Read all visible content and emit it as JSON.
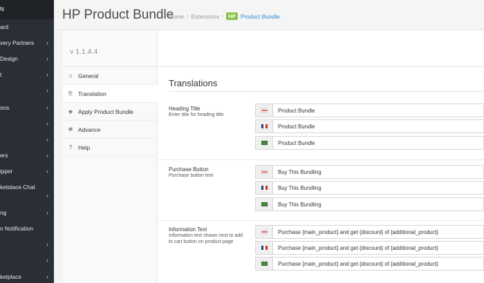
{
  "sidebar": {
    "header": "N",
    "items": [
      {
        "label": "ard",
        "chevron": false
      },
      {
        "label": "very Partners",
        "chevron": true
      },
      {
        "label": "Design",
        "chevron": true
      },
      {
        "label": "t",
        "chevron": true
      },
      {
        "label": "",
        "chevron": true
      },
      {
        "label": "ons",
        "chevron": true
      },
      {
        "label": "",
        "chevron": true
      },
      {
        "label": "",
        "chevron": true
      },
      {
        "label": "ers",
        "chevron": true
      },
      {
        "label": "ipper",
        "chevron": true
      },
      {
        "label": "ketplace Chat",
        "chevron": false
      },
      {
        "label": "",
        "chevron": true
      },
      {
        "label": "ng",
        "chevron": true
      },
      {
        "label": "n Notification",
        "chevron": false
      },
      {
        "label": "",
        "chevron": true
      },
      {
        "label": "",
        "chevron": true
      },
      {
        "label": "ketplace",
        "chevron": true
      }
    ]
  },
  "header": {
    "title": "HP Product Bundle",
    "breadcrumb": {
      "home": "Home",
      "extensions": "Extensions",
      "badge": "HP",
      "current": "Product Bundle"
    }
  },
  "version": "v 1.1.4.4",
  "tabs": [
    {
      "label": "General",
      "icon": "home-icon",
      "glyph": "⌂"
    },
    {
      "label": "Translation",
      "icon": "translation-icon",
      "glyph": "⎘"
    },
    {
      "label": "Apply Product Bundle",
      "icon": "cube-icon",
      "glyph": "◈"
    },
    {
      "label": "Advance",
      "icon": "cog-icon",
      "glyph": "✻"
    },
    {
      "label": "Help",
      "icon": "question-icon",
      "glyph": "?"
    }
  ],
  "active_tab": "Translation",
  "section_title": "Translations",
  "groups": [
    {
      "label": "Heading Title",
      "hint": "Enter title for heading title",
      "values": [
        "Product Bundle",
        "Product Bundle",
        "Product Bundle"
      ]
    },
    {
      "label": "Purchase Button",
      "hint": "Purchase button text",
      "values": [
        "Buy This Bundling",
        "Buy This Bundling",
        "Buy This Bundling"
      ]
    },
    {
      "label": "Information Text",
      "hint": "Information text shown next to add to cart button on product page",
      "values": [
        "Purchase {main_product} and get {discount} of {additional_product}",
        "Purchase {main_product} and get {discount} of {additional_product}",
        "Purchase {main_product} and get {discount} of {additional_product}"
      ]
    }
  ],
  "languages": [
    "english-flag-icon",
    "french-flag-icon",
    "arabic-flag-icon"
  ],
  "colors": {
    "sidebar_bg": "#2a2f35",
    "accent_link": "#2a8bd1",
    "badge_green": "#8bc34a"
  }
}
